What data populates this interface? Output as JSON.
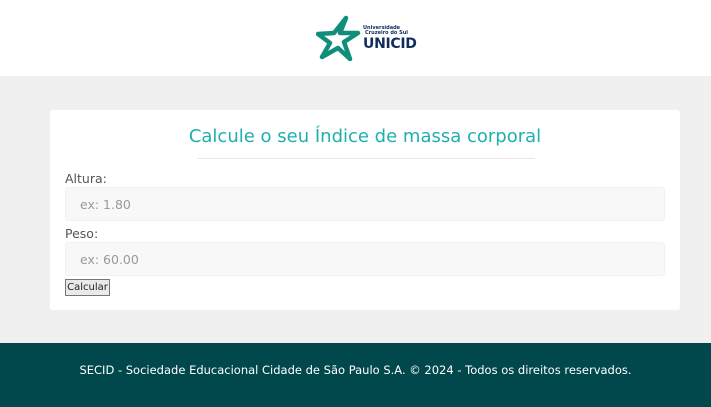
{
  "header": {
    "logo": {
      "line1": "Universidade",
      "line2": "Cruzeiro do Sul",
      "name": "UNICID",
      "icon": "star-logo-icon",
      "star_color": "#0f8f7a"
    }
  },
  "form": {
    "title": "Calcule o seu Índice de massa corporal",
    "height_label": "Altura:",
    "height_placeholder": "ex: 1.80",
    "height_value": "",
    "weight_label": "Peso:",
    "weight_placeholder": "ex: 60.00",
    "weight_value": "",
    "submit_label": "Calcular"
  },
  "footer": {
    "text": "SECID - Sociedade Educacional Cidade de São Paulo S.A. © 2024 - Todos os direitos reservados."
  },
  "colors": {
    "accent": "#1eafae",
    "footer_bg": "#00484c",
    "page_bg": "#f0f0f0"
  }
}
